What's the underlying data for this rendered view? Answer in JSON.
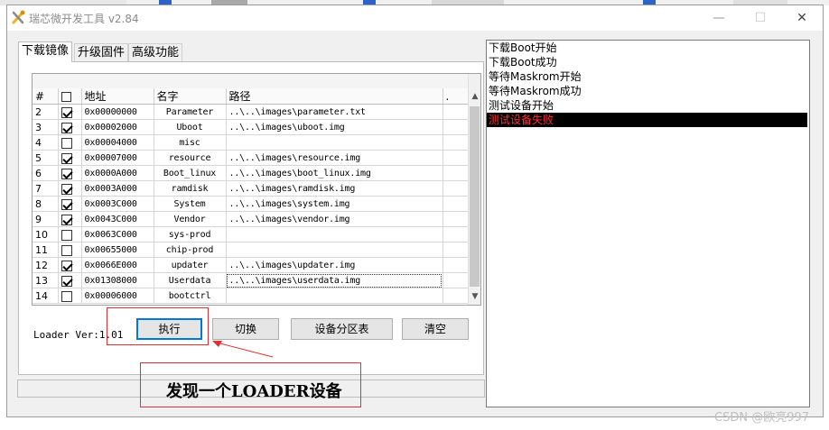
{
  "window": {
    "title": "瑞芯微开发工具 v2.84",
    "minimize_glyph": "—",
    "maximize_glyph": "☐",
    "close_glyph": "✕"
  },
  "tabs": [
    {
      "label": "下载镜像",
      "active": true
    },
    {
      "label": "升级固件",
      "active": false
    },
    {
      "label": "高级功能",
      "active": false
    }
  ],
  "table": {
    "headers": {
      "num": "#",
      "addr": "地址",
      "name": "名字",
      "path": "路径",
      "extra": "."
    },
    "rows": [
      {
        "num": "2",
        "checked": true,
        "addr": "0x00000000",
        "name": "Parameter",
        "path": "..\\..\\images\\parameter.txt"
      },
      {
        "num": "3",
        "checked": true,
        "addr": "0x00002000",
        "name": "Uboot",
        "path": "..\\..\\images\\uboot.img"
      },
      {
        "num": "4",
        "checked": false,
        "addr": "0x00004000",
        "name": "misc",
        "path": ""
      },
      {
        "num": "5",
        "checked": true,
        "addr": "0x00007000",
        "name": "resource",
        "path": "..\\..\\images\\resource.img"
      },
      {
        "num": "6",
        "checked": true,
        "addr": "0x0000A000",
        "name": "Boot_linux",
        "path": "..\\..\\images\\boot_linux.img"
      },
      {
        "num": "7",
        "checked": true,
        "addr": "0x0003A000",
        "name": "ramdisk",
        "path": "..\\..\\images\\ramdisk.img"
      },
      {
        "num": "8",
        "checked": true,
        "addr": "0x0003C000",
        "name": "System",
        "path": "..\\..\\images\\system.img"
      },
      {
        "num": "9",
        "checked": true,
        "addr": "0x0043C000",
        "name": "Vendor",
        "path": "..\\..\\images\\vendor.img"
      },
      {
        "num": "10",
        "checked": false,
        "addr": "0x0063C000",
        "name": "sys-prod",
        "path": ""
      },
      {
        "num": "11",
        "checked": false,
        "addr": "0x00655000",
        "name": "chip-prod",
        "path": ""
      },
      {
        "num": "12",
        "checked": true,
        "addr": "0x0066E000",
        "name": "updater",
        "path": "..\\..\\images\\updater.img"
      },
      {
        "num": "13",
        "checked": true,
        "addr": "0x01308000",
        "name": "Userdata",
        "path": "..\\..\\images\\userdata.img"
      },
      {
        "num": "14",
        "checked": false,
        "addr": "0x00006000",
        "name": "bootctrl",
        "path": ""
      }
    ]
  },
  "loader": {
    "label": "Loader Ver:1.01"
  },
  "buttons": {
    "run": "执行",
    "switch": "切换",
    "partition": "设备分区表",
    "clear": "清空"
  },
  "log": {
    "lines": [
      {
        "text": "下载Boot开始",
        "selected": false
      },
      {
        "text": "下载Boot成功",
        "selected": false
      },
      {
        "text": "等待Maskrom开始",
        "selected": false
      },
      {
        "text": "等待Maskrom成功",
        "selected": false
      },
      {
        "text": "测试设备开始",
        "selected": false
      },
      {
        "text": "测试设备失败",
        "selected": true
      }
    ]
  },
  "annotation": {
    "text": "发现一个LOADER设备",
    "color": "#e03030"
  },
  "watermark": "CSDN @欧亮997",
  "colors": {
    "accent": "#0078d7",
    "log_selected_bg": "#000000",
    "log_selected_fg": "#ff3030"
  }
}
